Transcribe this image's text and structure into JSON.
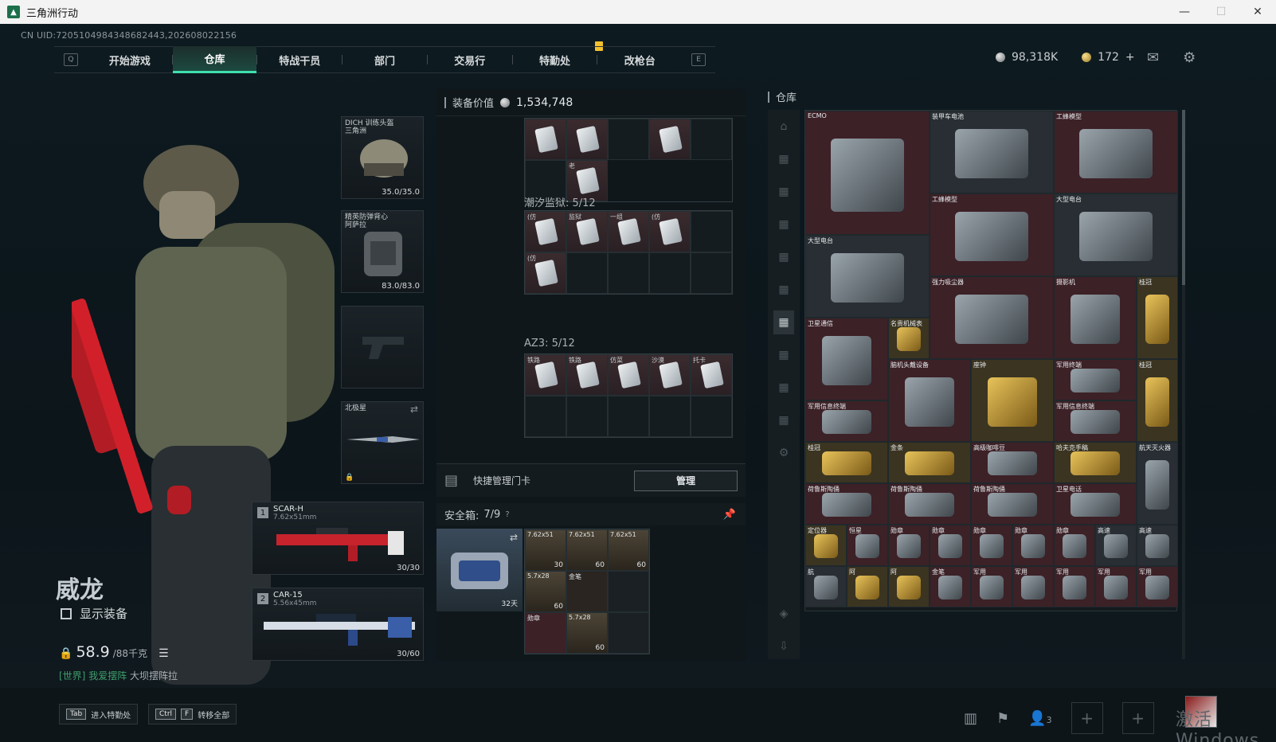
{
  "window": {
    "title": "三角洲行动",
    "minimize": "—",
    "maximize": "☐",
    "close": "✕"
  },
  "uid": "CN UID:7205104984348682443,202608022156",
  "nav": {
    "key_left": "Q",
    "key_right": "E",
    "tabs": [
      "开始游戏",
      "仓库",
      "特战干员",
      "部门",
      "交易行",
      "特勤处",
      "改枪台"
    ],
    "active_tab": "仓库"
  },
  "currency": {
    "silver": "98,318K",
    "gold": "172",
    "gold_plus": "+"
  },
  "character": {
    "name": "威龙",
    "show_equipment": "显示装备",
    "weight_value": "58.9",
    "weight_max": "/88千克",
    "world_tag": "[世界]",
    "world_user": "我爱摆阵",
    "world_msg": "大坝摆阵拉"
  },
  "equipment": {
    "helmet": {
      "name": "DICH 训练头盔",
      "sub": "三角洲",
      "durability": "35.0/35.0"
    },
    "armor": {
      "name": "精英防弹背心",
      "sub": "阿萨拉",
      "durability": "83.0/83.0"
    },
    "melee": {
      "name": "北极星"
    },
    "weapon1": {
      "index": "1",
      "name": "SCAR-H",
      "caliber": "7.62x51mm",
      "ammo": "30/30"
    },
    "weapon2": {
      "index": "2",
      "name": "CAR-15",
      "caliber": "5.56x45mm",
      "ammo": "30/60"
    }
  },
  "middle": {
    "equip_value_label": "装备价值",
    "equip_value": "1,534,748",
    "top_items": [
      "",
      "",
      "",
      "",
      "老"
    ],
    "section1": {
      "title": "潮汐监狱: 5/12",
      "items": [
        "(仿",
        "监狱",
        "一组",
        "(仿",
        "(仿"
      ]
    },
    "section2": {
      "title": "AZ3: 5/12",
      "items": [
        "铁路",
        "铁路",
        "仿菜",
        "沙漠",
        "托卡"
      ]
    },
    "quick_label": "快捷管理门卡",
    "manage_btn": "管理",
    "safebox_label": "安全箱:",
    "safebox_count": "7/9",
    "safebox_help": "?",
    "safebox_expire": "32天",
    "safe_items": [
      {
        "label": "7.62x51",
        "count": "30"
      },
      {
        "label": "7.62x51",
        "count": "60"
      },
      {
        "label": "7.62x51",
        "count": "60"
      },
      {
        "label": "5.7x28",
        "count": "60"
      },
      {
        "label": "金笔",
        "count": ""
      },
      {
        "label": "勋章",
        "count": ""
      },
      {
        "label": "5.7x28",
        "count": "60"
      }
    ]
  },
  "stash": {
    "title": "仓库",
    "items": [
      {
        "label": "ECMO",
        "cls": "",
        "col": 1,
        "row": 1,
        "w": 3,
        "h": 3
      },
      {
        "label": "装甲车电池",
        "cls": "gray",
        "col": 4,
        "row": 1,
        "w": 3,
        "h": 2
      },
      {
        "label": "工蜂模型",
        "cls": "",
        "col": 7,
        "row": 1,
        "w": 3,
        "h": 2
      },
      {
        "label": "工蜂模型",
        "cls": "",
        "col": 4,
        "row": 3,
        "w": 3,
        "h": 2
      },
      {
        "label": "大型电台",
        "cls": "gray",
        "col": 7,
        "row": 3,
        "w": 3,
        "h": 2
      },
      {
        "label": "大型电台",
        "cls": "gray",
        "col": 1,
        "row": 4,
        "w": 3,
        "h": 2
      },
      {
        "label": "强力吸尘器",
        "cls": "",
        "col": 4,
        "row": 5,
        "w": 3,
        "h": 2
      },
      {
        "label": "摄影机",
        "cls": "",
        "col": 7,
        "row": 5,
        "w": 2,
        "h": 2
      },
      {
        "label": "桂冠",
        "cls": "gold",
        "col": 9,
        "row": 5,
        "w": 1,
        "h": 2
      },
      {
        "label": "卫星通信",
        "cls": "",
        "col": 1,
        "row": 6,
        "w": 2,
        "h": 2
      },
      {
        "label": "名贵机械表",
        "cls": "gold",
        "col": 3,
        "row": 6,
        "w": 1,
        "h": 1
      },
      {
        "label": "脑机头戴设备",
        "cls": "",
        "col": 3,
        "row": 7,
        "w": 2,
        "h": 2
      },
      {
        "label": "座钟",
        "cls": "gold",
        "col": 5,
        "row": 7,
        "w": 2,
        "h": 2
      },
      {
        "label": "军用终端",
        "cls": "",
        "col": 7,
        "row": 7,
        "w": 2,
        "h": 1
      },
      {
        "label": "桂冠",
        "cls": "gold",
        "col": 9,
        "row": 7,
        "w": 1,
        "h": 2
      },
      {
        "label": "军用信息终端",
        "cls": "",
        "col": 1,
        "row": 8,
        "w": 2,
        "h": 1
      },
      {
        "label": "军用信息终端",
        "cls": "",
        "col": 7,
        "row": 8,
        "w": 2,
        "h": 1
      },
      {
        "label": "桂冠",
        "cls": "gold",
        "col": 1,
        "row": 9,
        "w": 2,
        "h": 1
      },
      {
        "label": "金条",
        "cls": "gold",
        "col": 3,
        "row": 9,
        "w": 2,
        "h": 1
      },
      {
        "label": "高级咖啡豆",
        "cls": "",
        "col": 5,
        "row": 9,
        "w": 2,
        "h": 1
      },
      {
        "label": "哈夫克手稿",
        "cls": "gold",
        "col": 7,
        "row": 9,
        "w": 2,
        "h": 1
      },
      {
        "label": "航天灭火器",
        "cls": "gray",
        "col": 9,
        "row": 9,
        "w": 1,
        "h": 2
      },
      {
        "label": "荷鲁斯陶俑",
        "cls": "",
        "col": 1,
        "row": 10,
        "w": 2,
        "h": 1
      },
      {
        "label": "荷鲁斯陶俑",
        "cls": "",
        "col": 3,
        "row": 10,
        "w": 2,
        "h": 1
      },
      {
        "label": "荷鲁斯陶俑",
        "cls": "",
        "col": 5,
        "row": 10,
        "w": 2,
        "h": 1
      },
      {
        "label": "卫星电话",
        "cls": "",
        "col": 7,
        "row": 10,
        "w": 2,
        "h": 1
      },
      {
        "label": "定位器",
        "cls": "gold",
        "col": 1,
        "row": 11,
        "w": 1,
        "h": 1
      },
      {
        "label": "恒星",
        "cls": "",
        "col": 2,
        "row": 11,
        "w": 1,
        "h": 1
      },
      {
        "label": "勋章",
        "cls": "",
        "col": 3,
        "row": 11,
        "w": 1,
        "h": 1
      },
      {
        "label": "勋章",
        "cls": "",
        "col": 4,
        "row": 11,
        "w": 1,
        "h": 1
      },
      {
        "label": "勋章",
        "cls": "",
        "col": 5,
        "row": 11,
        "w": 1,
        "h": 1
      },
      {
        "label": "勋章",
        "cls": "",
        "col": 6,
        "row": 11,
        "w": 1,
        "h": 1
      },
      {
        "label": "勋章",
        "cls": "",
        "col": 7,
        "row": 11,
        "w": 1,
        "h": 1
      },
      {
        "label": "高速",
        "cls": "gray",
        "col": 8,
        "row": 11,
        "w": 1,
        "h": 1
      },
      {
        "label": "高速",
        "cls": "gray",
        "col": 9,
        "row": 11,
        "w": 1,
        "h": 1
      },
      {
        "label": "航",
        "cls": "gray",
        "col": 1,
        "row": 12,
        "w": 1,
        "h": 1
      },
      {
        "label": "阿",
        "cls": "gold",
        "col": 2,
        "row": 12,
        "w": 1,
        "h": 1
      },
      {
        "label": "阿",
        "cls": "gold",
        "col": 3,
        "row": 12,
        "w": 1,
        "h": 1
      },
      {
        "label": "金笔",
        "cls": "",
        "col": 4,
        "row": 12,
        "w": 1,
        "h": 1
      },
      {
        "label": "军用",
        "cls": "",
        "col": 5,
        "row": 12,
        "w": 1,
        "h": 1
      },
      {
        "label": "军用",
        "cls": "",
        "col": 6,
        "row": 12,
        "w": 1,
        "h": 1
      },
      {
        "label": "军用",
        "cls": "",
        "col": 7,
        "row": 12,
        "w": 1,
        "h": 1
      },
      {
        "label": "军用",
        "cls": "",
        "col": 8,
        "row": 12,
        "w": 1,
        "h": 1
      },
      {
        "label": "军用",
        "cls": "",
        "col": 9,
        "row": 12,
        "w": 1,
        "h": 1
      }
    ]
  },
  "bottom": {
    "key1": "Tab",
    "key1_label": "进入特勤处",
    "key2a": "Ctrl",
    "key2b": "F",
    "key2_label": "转移全部",
    "friends": "3",
    "watermark": "激活 Windows"
  }
}
